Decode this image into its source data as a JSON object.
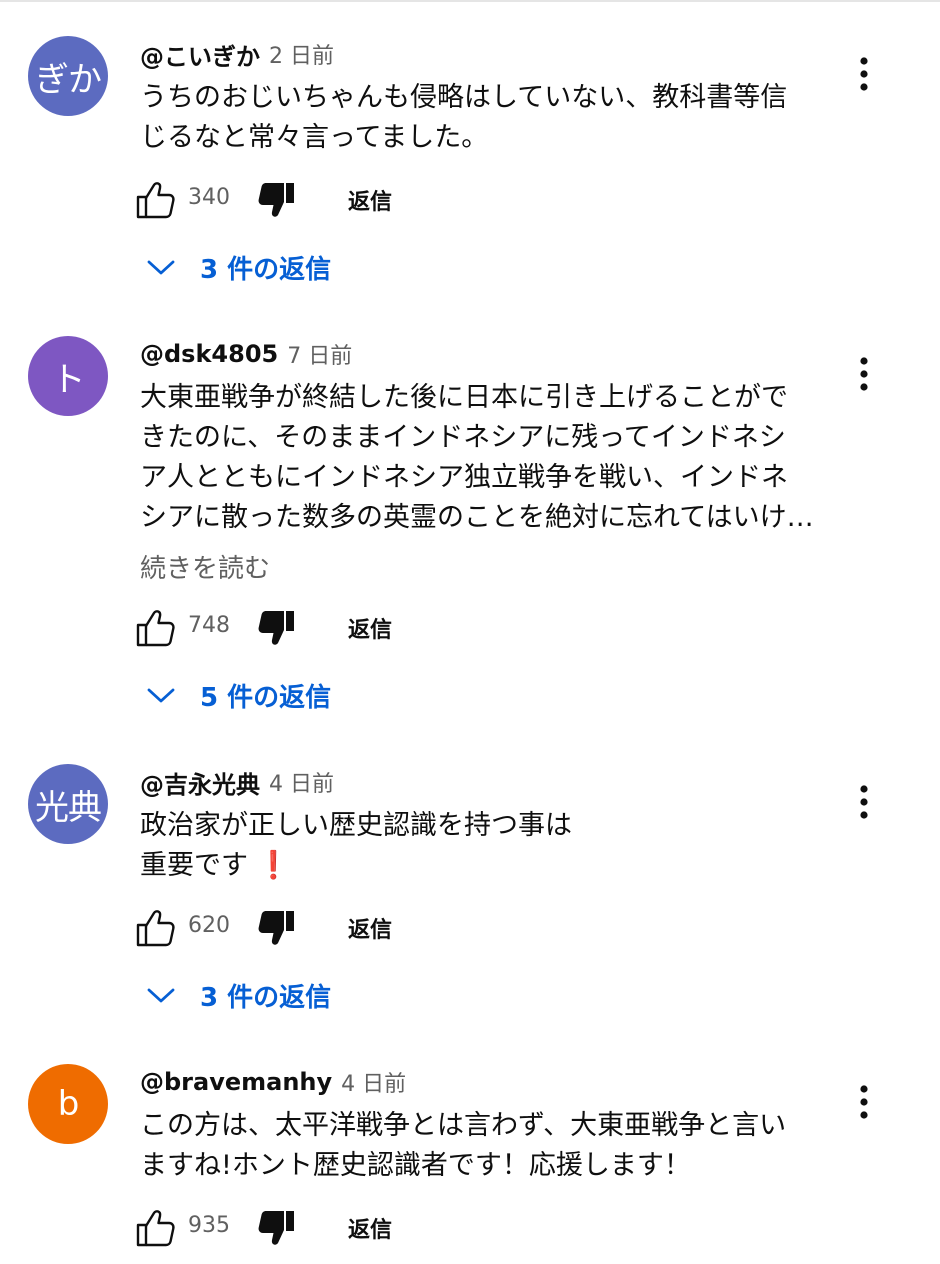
{
  "comments": [
    {
      "avatar_text": "ぎか",
      "avatar_color": "#5c6bc0",
      "handle": "@こいぎか",
      "time": "2 日前",
      "lines": [
        "うちのおじいちゃんも侵略はしていない、教科書等信",
        "じるなと常々言ってました。"
      ],
      "likes": "340",
      "reply_label": "返信",
      "replies_label": "3 件の返信"
    },
    {
      "avatar_text": "ト",
      "avatar_color": "#7e57c2",
      "handle": "@dsk4805",
      "time": "7 日前",
      "lines": [
        "大東亜戦争が終結した後に日本に引き上げることがで",
        "きたのに、そのままインドネシアに残ってインドネシ",
        "ア人とともにインドネシア独立戦争を戦い、インドネ",
        "シアに散った数多の英霊のことを絶対に忘れてはいけ…"
      ],
      "read_more": "続きを読む",
      "likes": "748",
      "reply_label": "返信",
      "replies_label": "5 件の返信"
    },
    {
      "avatar_text": "光典",
      "avatar_color": "#5c6bc0",
      "handle": "@吉永光典",
      "time": "4 日前",
      "lines": [
        "政治家が正しい歴史認識を持つ事は",
        "重要です"
      ],
      "emoji": "❗",
      "likes": "620",
      "reply_label": "返信",
      "replies_label": "3 件の返信"
    },
    {
      "avatar_text": "b",
      "avatar_color": "#ef6c00",
      "handle": "@bravemanhy",
      "time": "4 日前",
      "lines": [
        "この方は、太平洋戦争とは言わず、大東亜戦争と言い",
        "ますね!ホント歴史認識者です！応援します！"
      ],
      "likes": "935",
      "reply_label": "返信"
    }
  ],
  "icons": {
    "like": "thumb-up-outline-icon",
    "dislike": "thumb-down-filled-icon",
    "more": "vertical-dots-icon",
    "expand": "chevron-down-icon"
  },
  "colors": {
    "link_blue": "#065fd4",
    "secondary_text": "#606060",
    "primary_text": "#0f0f0f"
  }
}
